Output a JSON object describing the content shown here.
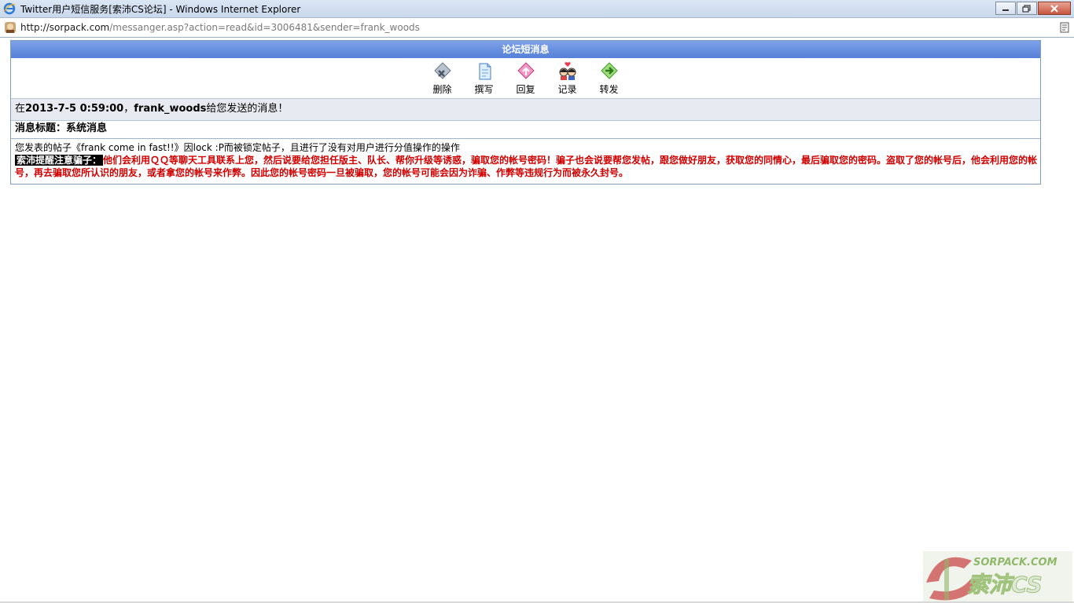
{
  "window": {
    "title": "Twitter用户短信服务[索沛CS论坛] - Windows Internet Explorer"
  },
  "address": {
    "host": "http://sorpack.com",
    "path": "/messanger.asp?action=read&id=3006481&sender=frank_woods"
  },
  "panel": {
    "header": "论坛短消息",
    "tools": [
      {
        "label": "删除",
        "icon": "delete-icon"
      },
      {
        "label": "撰写",
        "icon": "compose-icon"
      },
      {
        "label": "回复",
        "icon": "reply-icon"
      },
      {
        "label": "记录",
        "icon": "history-icon"
      },
      {
        "label": "转发",
        "icon": "forward-icon"
      }
    ],
    "meta": {
      "prefix": "在",
      "datetime": "2013-7-5 0:59:00",
      "sep": "，",
      "sender": "frank_woods",
      "suffix": "给您发送的消息！"
    },
    "subject": "消息标题：系统消息",
    "body": "您发表的帖子《frank come in fast!!》因lock :P而被锁定帖子，且进行了没有对用户进行分值操作的操作",
    "warning_label": "索沛提醒注意骗子：",
    "warning": "他们会利用ＱＱ等聊天工具联系上您，然后说要给您担任版主、队长、帮你升级等诱惑，骗取您的帐号密码！骗子也会说要帮您发帖，跟您做好朋友，获取您的同情心，最后骗取您的密码。盗取了您的帐号后，他会利用您的帐号，再去骗取您所认识的朋友，或者拿您的帐号来作弊。因此您的帐号密码一旦被骗取，您的帐号可能会因为诈骗、作弊等违规行为而被永久封号。"
  },
  "watermark": {
    "top": "SORPACK.COM",
    "bottom": "索沛CS"
  }
}
